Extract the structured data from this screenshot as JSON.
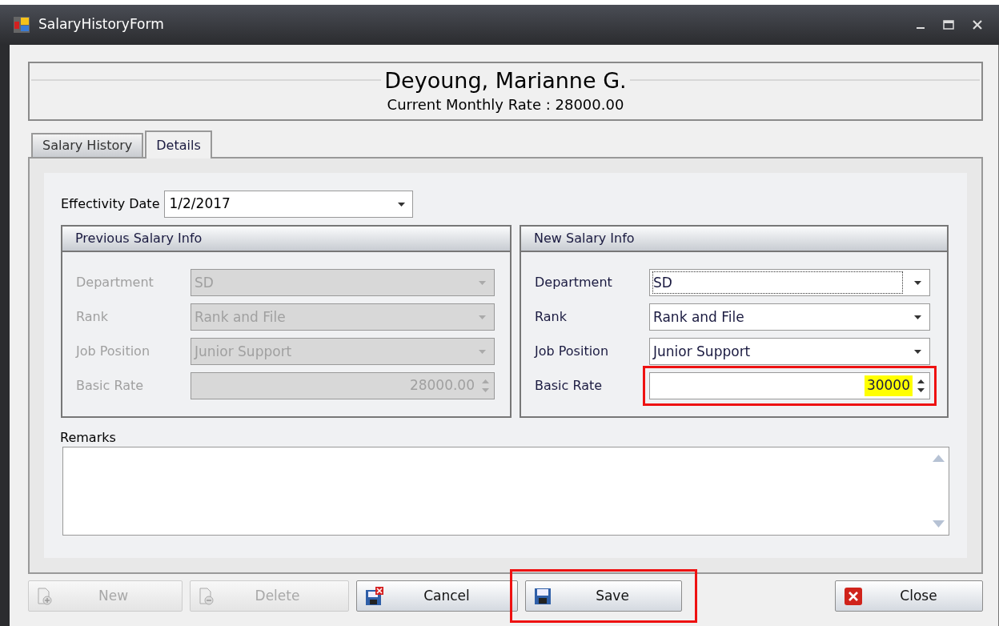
{
  "window": {
    "title": "SalaryHistoryForm"
  },
  "header": {
    "name": "Deyoung, Marianne G.",
    "subtitle": "Current Monthly Rate : 28000.00"
  },
  "tabs": [
    {
      "label": "Salary History",
      "selected": false
    },
    {
      "label": "Details",
      "selected": true
    }
  ],
  "effectivity_date": {
    "label": "Effectivity Date",
    "value": "1/2/2017"
  },
  "groups": [
    {
      "title": "Previous Salary Info",
      "disabled": true,
      "fields": [
        {
          "kind": "dropdown",
          "label": "Department",
          "value": "SD",
          "focused": false
        },
        {
          "kind": "dropdown",
          "label": "Rank",
          "value": "Rank and File",
          "focused": false
        },
        {
          "kind": "dropdown",
          "label": "Job Position",
          "value": "Junior Support",
          "focused": false
        },
        {
          "kind": "spinner",
          "label": "Basic Rate",
          "value": "28000.00",
          "highlighted": false,
          "value_selected": false
        }
      ]
    },
    {
      "title": "New Salary Info",
      "disabled": false,
      "fields": [
        {
          "kind": "dropdown",
          "label": "Department",
          "value": "SD",
          "focused": true
        },
        {
          "kind": "dropdown",
          "label": "Rank",
          "value": "Rank and File",
          "focused": false
        },
        {
          "kind": "dropdown",
          "label": "Job Position",
          "value": "Junior Support",
          "focused": false
        },
        {
          "kind": "spinner",
          "label": "Basic Rate",
          "value": "30000",
          "highlighted": true,
          "value_selected": true
        }
      ]
    }
  ],
  "remarks": {
    "label": "Remarks"
  },
  "buttons": [
    {
      "kind": "new",
      "label": "New",
      "disabled": true,
      "highlighted": false
    },
    {
      "kind": "delete",
      "label": "Delete",
      "disabled": true,
      "highlighted": false
    },
    {
      "kind": "cancel",
      "label": "Cancel",
      "disabled": false,
      "highlighted": false
    },
    {
      "kind": "save",
      "label": "Save",
      "disabled": false,
      "highlighted": true
    },
    {
      "kind": "close",
      "label": "Close",
      "disabled": false,
      "highlighted": false
    }
  ]
}
